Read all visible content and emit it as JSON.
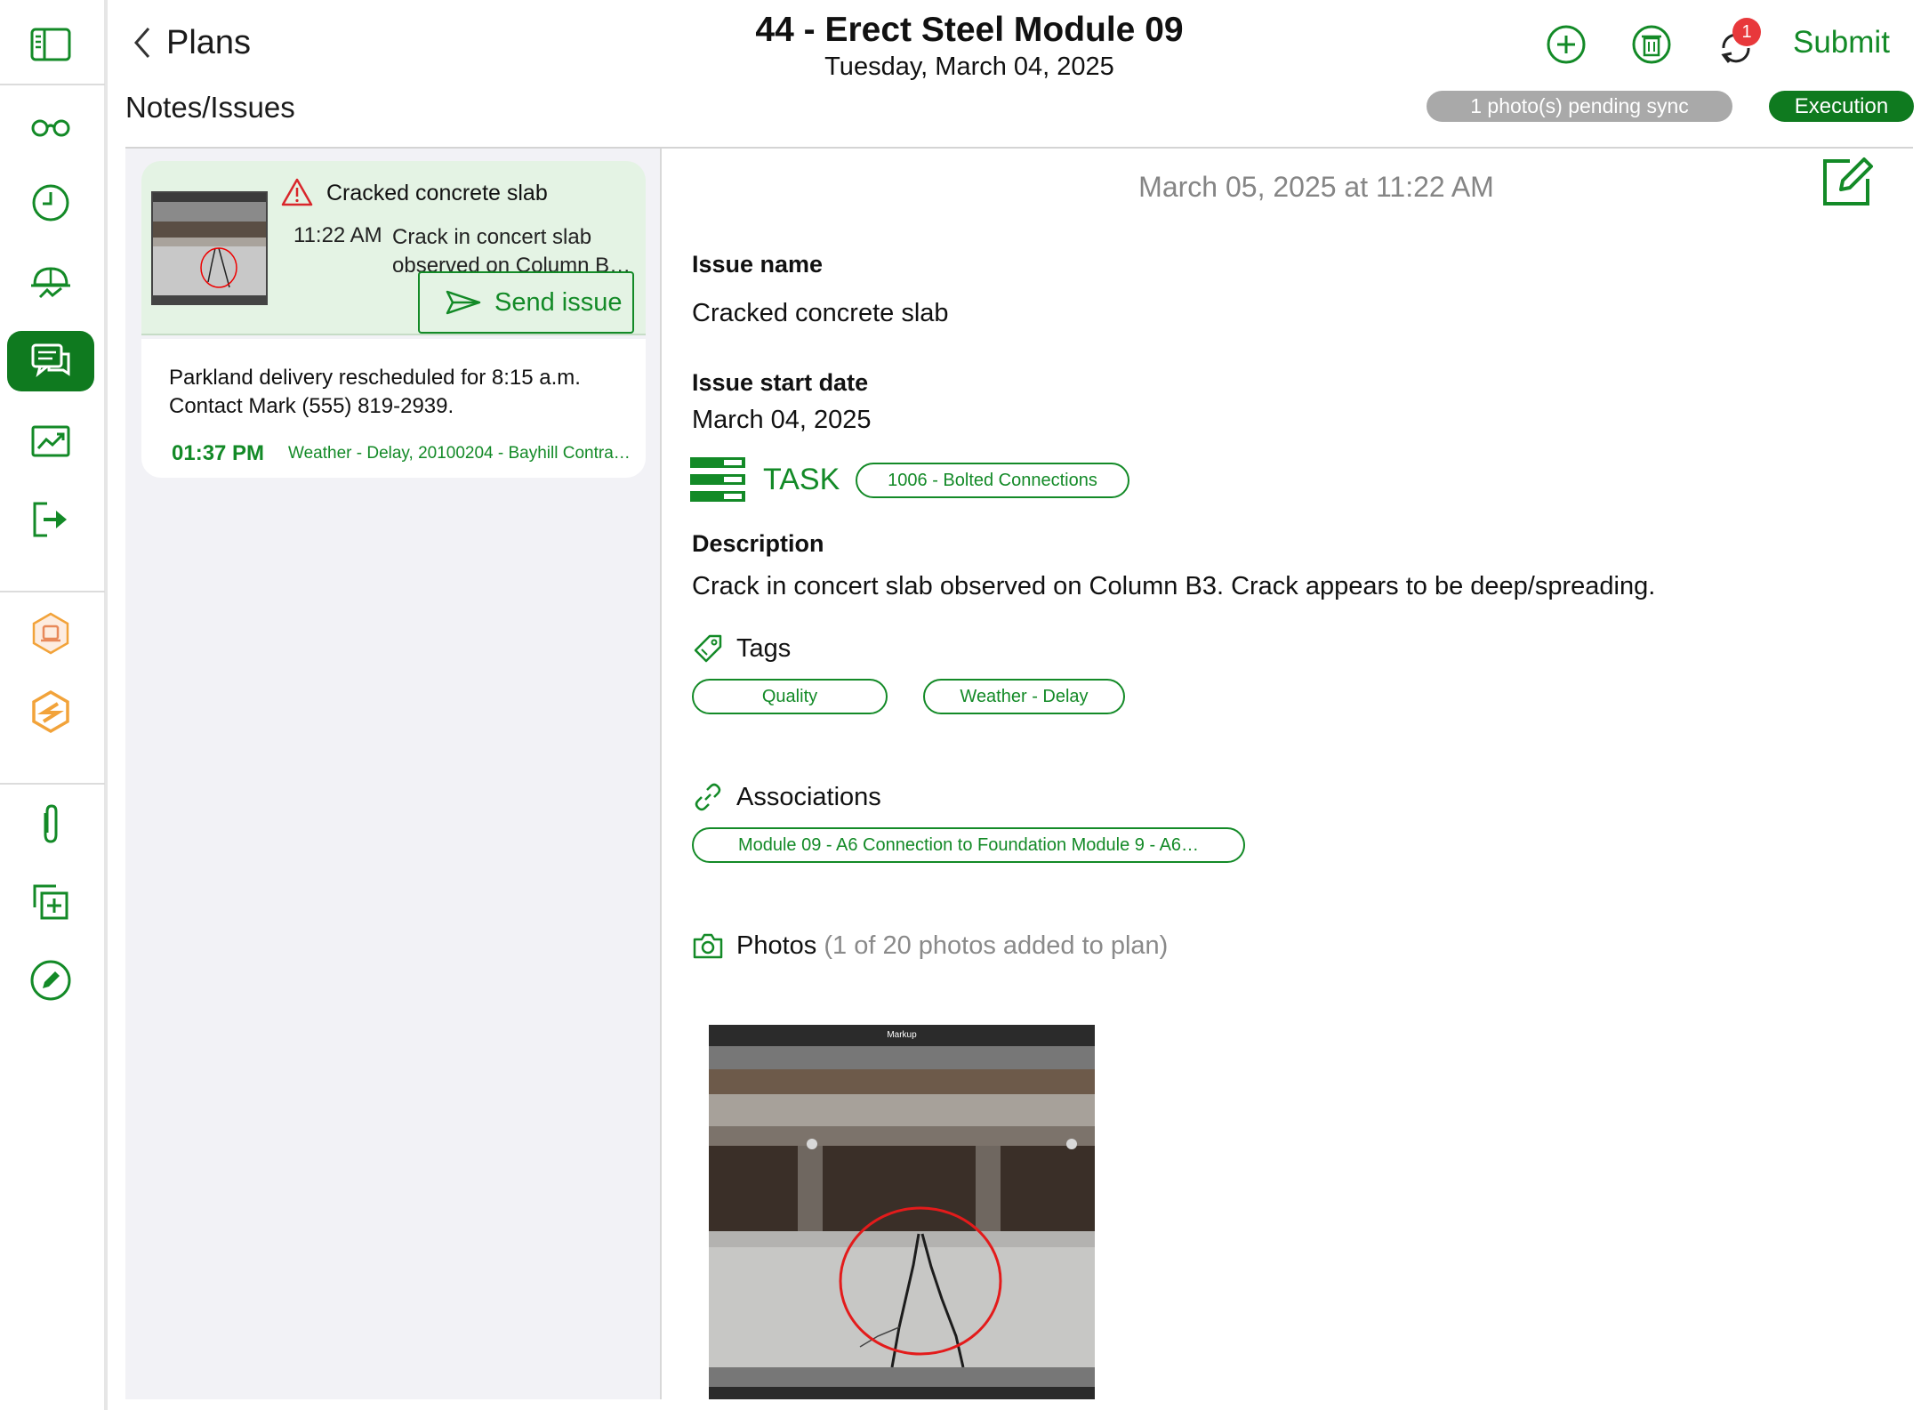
{
  "header": {
    "back_label": "Plans",
    "title": "44 - Erect Steel Module 09",
    "date": "Tuesday, March 04, 2025",
    "sync_badge_count": "1",
    "submit_label": "Submit",
    "section_title": "Notes/Issues",
    "sync_status": "1 photo(s) pending sync",
    "phase": "Execution"
  },
  "list": {
    "items": [
      {
        "title": "Cracked concrete slab",
        "time": "11:22 AM",
        "text": "Crack in concert slab observed on Column B…",
        "action_label": "Send issue"
      },
      {
        "text": "Parkland delivery rescheduled for 8:15 a.m. Contact Mark (555) 819-2939.",
        "time": "01:37 PM",
        "meta": "Weather - Delay, 20100204 - Bayhill Contra…"
      }
    ]
  },
  "detail": {
    "timestamp": "March 05, 2025 at 11:22 AM",
    "issue_name_label": "Issue name",
    "issue_name": "Cracked concrete slab",
    "start_date_label": "Issue start date",
    "start_date": "March 04, 2025",
    "task_label": "TASK",
    "task_code": "1006  -  Bolted Connections",
    "description_label": "Description",
    "description": "Crack in concert slab observed on Column B3. Crack appears to be deep/spreading.",
    "tags_label": "Tags",
    "tags": [
      "Quality",
      "Weather  -  Delay"
    ],
    "associations_label": "Associations",
    "association": "Module 09 - A6 Connection to Foundation Module 9 - A6…",
    "photos_label": "Photos",
    "photos_sub": "(1 of 20 photos added to plan)",
    "photo_caption": "Markup"
  },
  "colors": {
    "brand_green": "#0f7a1f",
    "text_green": "#138a27",
    "pending_gray": "#a9a9a9",
    "badge_red": "#e8383b",
    "warning_red": "#d9262b",
    "hex_orange": "#f2a33a"
  },
  "icons": {
    "sidebar": [
      "sidebar-toggle-icon",
      "glasses-icon",
      "clock-icon",
      "hardhat-icon",
      "chat-icon",
      "chart-icon",
      "exit-icon",
      "hex-badge-icon",
      "hex-logo-icon",
      "paperclip-icon",
      "copy-add-icon",
      "pencil-icon"
    ],
    "header": [
      "chevron-left-icon",
      "add-circle-icon",
      "trash-icon",
      "sync-icon"
    ],
    "detail": [
      "edit-icon",
      "task-icon",
      "tag-icon",
      "link-icon",
      "camera-icon",
      "warning-icon",
      "send-icon"
    ]
  }
}
